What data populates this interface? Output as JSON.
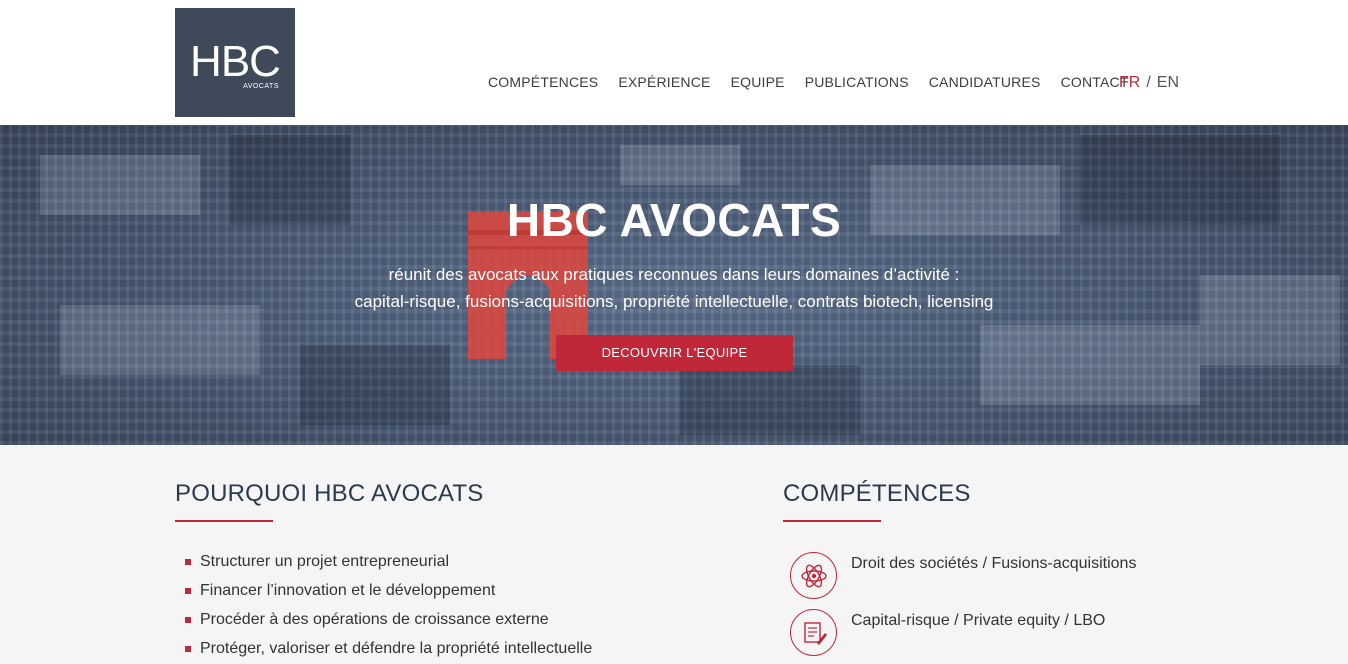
{
  "header": {
    "logo": {
      "mark": "HBC",
      "tagline": "AVOCATS"
    },
    "nav": [
      "COMPÉTENCES",
      "EXPÉRIENCE",
      "EQUIPE",
      "PUBLICATIONS",
      "CANDIDATURES",
      "CONTACT"
    ],
    "lang": {
      "fr": "FR",
      "separator": "/",
      "en": "EN",
      "active": "FR"
    }
  },
  "hero": {
    "title": "HBC AVOCATS",
    "subtitle_line1": "réunit des avocats aux pratiques reconnues dans leurs domaines d’activité :",
    "subtitle_line2": "capital-risque, fusions-acquisitions, propriété intellectuelle, contrats biotech, licensing",
    "cta_label": "DECOUVRIR L'EQUIPE"
  },
  "why": {
    "title": "POURQUOI HBC AVOCATS",
    "items": [
      "Structurer un projet entrepreneurial",
      "Financer l’innovation et le développement",
      "Procéder à des opérations de croissance externe",
      "Protéger, valoriser et défendre la propriété intellectuelle"
    ]
  },
  "competences": {
    "title": "COMPÉTENCES",
    "items": [
      {
        "label": "Droit des sociétés / Fusions-acquisitions",
        "icon": "atom-icon"
      },
      {
        "label": "Capital-risque / Private equity / LBO",
        "icon": "document-pen-icon"
      }
    ]
  },
  "colors": {
    "accent": "#c0283a",
    "logo_bg": "#3e4a5a",
    "title_text": "#2b3a4e"
  }
}
